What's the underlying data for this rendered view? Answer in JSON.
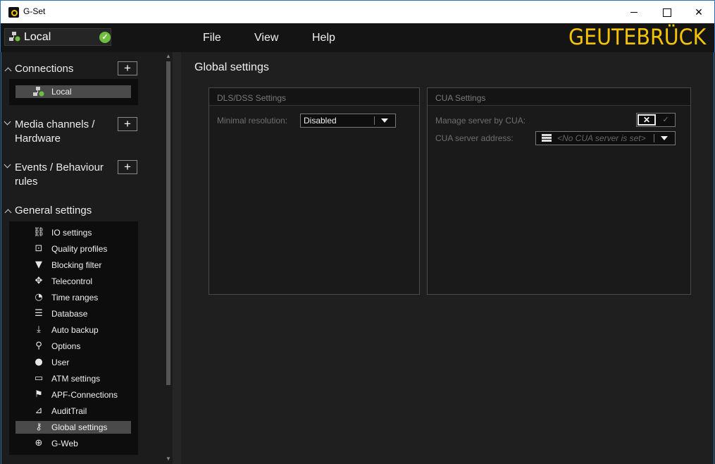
{
  "window": {
    "title": "G-Set"
  },
  "menubar": {
    "connection": "Local",
    "menus": [
      "File",
      "View",
      "Help"
    ],
    "brand": "GEUTEBRÜCK"
  },
  "sidebar": {
    "connections": {
      "label": "Connections",
      "items": [
        "Local"
      ]
    },
    "media": {
      "label_line1": "Media channels /",
      "label_line2": "Hardware"
    },
    "events": {
      "label_line1": "Events / Behaviour",
      "label_line2": "rules"
    },
    "general": {
      "label": "General settings",
      "items": [
        {
          "label": "IO settings",
          "icon": "io-icon"
        },
        {
          "label": "Quality profiles",
          "icon": "star-icon"
        },
        {
          "label": "Blocking filter",
          "icon": "filter-icon"
        },
        {
          "label": "Telecontrol",
          "icon": "move-icon"
        },
        {
          "label": "Time ranges",
          "icon": "clock-icon"
        },
        {
          "label": "Database",
          "icon": "database-icon"
        },
        {
          "label": "Auto backup",
          "icon": "download-icon"
        },
        {
          "label": "Options",
          "icon": "wrench-icon"
        },
        {
          "label": "User",
          "icon": "user-icon"
        },
        {
          "label": "ATM settings",
          "icon": "atm-icon"
        },
        {
          "label": "APF-Connections",
          "icon": "apf-icon"
        },
        {
          "label": "AuditTrail",
          "icon": "audit-icon"
        },
        {
          "label": "Global settings",
          "icon": "global-settings-icon"
        },
        {
          "label": "G-Web",
          "icon": "globe-icon"
        }
      ],
      "selected": "Global settings"
    }
  },
  "main": {
    "title": "Global settings",
    "dls": {
      "title": "DLS/DSS Settings",
      "min_res_label": "Minimal resolution:",
      "min_res_value": "Disabled"
    },
    "cua": {
      "title": "CUA Settings",
      "manage_label": "Manage server by CUA:",
      "address_label": "CUA server address:",
      "address_placeholder": "<No CUA server is set>"
    }
  },
  "colors": {
    "brand": "#f5c400",
    "ok": "#6fbf3f",
    "selected": "#4a4a4a"
  }
}
